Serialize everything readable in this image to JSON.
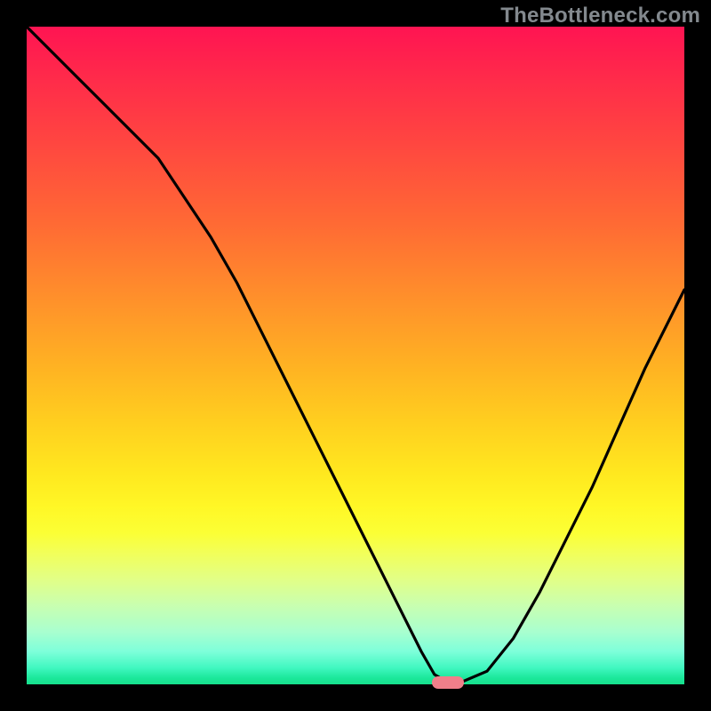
{
  "watermark": "TheBottleneck.com",
  "colors": {
    "frame_bg": "#000000",
    "curve_stroke": "#000000",
    "marker_fill": "#f07f8a",
    "watermark_text": "#83898e"
  },
  "chart_data": {
    "type": "line",
    "title": "",
    "xlabel": "",
    "ylabel": "",
    "xlim": [
      0,
      100
    ],
    "ylim": [
      0,
      100
    ],
    "grid": false,
    "series": [
      {
        "name": "bottleneck-curve",
        "x": [
          0,
          4,
          8,
          12,
          16,
          20,
          24,
          28,
          32,
          36,
          40,
          44,
          48,
          52,
          56,
          60,
          62,
          64,
          66,
          70,
          74,
          78,
          82,
          86,
          90,
          94,
          98,
          100
        ],
        "y": [
          100,
          96,
          92,
          88,
          84,
          80,
          74,
          68,
          61,
          53,
          45,
          37,
          29,
          21,
          13,
          5,
          1.5,
          0.3,
          0.3,
          2,
          7,
          14,
          22,
          30,
          39,
          48,
          56,
          60
        ]
      }
    ],
    "marker": {
      "x": 64,
      "y": 0.3
    },
    "gradient_stops": [
      {
        "pct": 0,
        "color": "#ff1452"
      },
      {
        "pct": 50,
        "color": "#ffbf21"
      },
      {
        "pct": 80,
        "color": "#f2ff59"
      },
      {
        "pct": 100,
        "color": "#16df8c"
      }
    ]
  }
}
